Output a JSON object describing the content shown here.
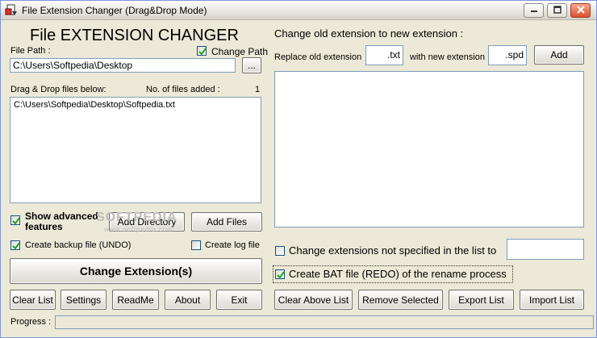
{
  "window": {
    "title": "File Extension Changer (Drag&Drop Mode)"
  },
  "left": {
    "heading": "File EXTENSION CHANGER",
    "file_path_label": "File Path :",
    "change_path_label": "Change Path",
    "change_path_checked": true,
    "file_path_value": "C:\\Users\\Softpedia\\Desktop",
    "browse_label": "...",
    "drag_drop_label": "Drag & Drop files below:",
    "files_added_label": "No. of files added :",
    "files_added_count": "1",
    "files": [
      "C:\\Users\\Softpedia\\Desktop\\Softpedia.txt"
    ],
    "show_advanced_label": "Show advanced features",
    "show_advanced_checked": true,
    "add_directory_label": "Add Directory",
    "add_files_label": "Add Files",
    "create_backup_label": "Create backup file (UNDO)",
    "create_backup_checked": true,
    "create_log_label": "Create log file",
    "create_log_checked": false,
    "change_extension_label": "Change Extension(s)"
  },
  "right": {
    "heading": "Change old extension to new extension :",
    "replace_label": "Replace old extension",
    "old_ext_value": ".txt",
    "with_new_label": "with new extension",
    "new_ext_value": ".spd",
    "add_label": "Add",
    "change_unspecified_label": "Change extensions not specified in the list to",
    "change_unspecified_checked": false,
    "change_unspecified_value": "",
    "create_bat_label": "Create BAT file (REDO) of the rename process",
    "create_bat_checked": true
  },
  "bottom_buttons": {
    "clear_list": "Clear List",
    "settings": "Settings",
    "readme": "ReadMe",
    "about": "About",
    "exit": "Exit",
    "clear_above_list": "Clear Above List",
    "remove_selected": "Remove Selected",
    "export_list": "Export List",
    "import_list": "Import List"
  },
  "status": {
    "progress_label": "Progress :",
    "progress_value": 0
  },
  "watermark": {
    "text": "SOFTPEDIA",
    "subtext": "www.softpedia.com"
  }
}
